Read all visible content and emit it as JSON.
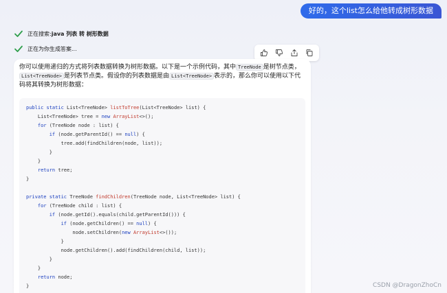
{
  "user_message": "好的，这个list怎么给他转成树形数据",
  "status": [
    {
      "prefix": "正在搜索: ",
      "bold": "java 列表 转 树形数据"
    },
    {
      "prefix": "正在为你生成答案...",
      "bold": ""
    }
  ],
  "toolbar": [
    "thumbs-up-icon",
    "thumbs-down-icon",
    "share-icon",
    "copy-icon"
  ],
  "answer": {
    "p1": "你可以使用递归的方式将列表数据转换为树形数据。以下是一个示例代码，其中",
    "c1": "TreeNode",
    "p2": "是树节点类，",
    "c2": "List<TreeNode>",
    "p3": "是列表节点类。假设你的列表数据是由",
    "c3": "List<TreeNode>",
    "p4": "表示的，那么你可以使用以下代码将其转换为树形数据："
  },
  "code_lines": [
    [
      {
        "t": "public static ",
        "c": "kw"
      },
      {
        "t": "List<TreeNode> "
      },
      {
        "t": "listToTree",
        "c": "fn"
      },
      {
        "t": "(List<TreeNode> list) {"
      }
    ],
    [
      {
        "t": "    List<TreeNode> tree = "
      },
      {
        "t": "new ",
        "c": "kw"
      },
      {
        "t": "ArrayList",
        "c": "fn"
      },
      {
        "t": "<>();"
      }
    ],
    [
      {
        "t": "    "
      },
      {
        "t": "for ",
        "c": "kw"
      },
      {
        "t": "(TreeNode node : list) {"
      }
    ],
    [
      {
        "t": "        "
      },
      {
        "t": "if ",
        "c": "kw"
      },
      {
        "t": "(node.getParentId() == "
      },
      {
        "t": "null",
        "c": "kw"
      },
      {
        "t": ") {"
      }
    ],
    [
      {
        "t": "            tree.add(findChildren(node, list));"
      }
    ],
    [
      {
        "t": "        }"
      }
    ],
    [
      {
        "t": "    }"
      }
    ],
    [
      {
        "t": "    "
      },
      {
        "t": "return ",
        "c": "kw"
      },
      {
        "t": "tree;"
      }
    ],
    [
      {
        "t": "}"
      }
    ],
    [
      {
        "t": ""
      }
    ],
    [
      {
        "t": "private static ",
        "c": "kw"
      },
      {
        "t": "TreeNode "
      },
      {
        "t": "findChildren",
        "c": "fn"
      },
      {
        "t": "(TreeNode node, List<TreeNode> list) {"
      }
    ],
    [
      {
        "t": "    "
      },
      {
        "t": "for ",
        "c": "kw"
      },
      {
        "t": "(TreeNode child : list) {"
      }
    ],
    [
      {
        "t": "        "
      },
      {
        "t": "if ",
        "c": "kw"
      },
      {
        "t": "(node.getId().equals(child.getParentId())) {"
      }
    ],
    [
      {
        "t": "            "
      },
      {
        "t": "if ",
        "c": "kw"
      },
      {
        "t": "(node.getChildren() == "
      },
      {
        "t": "null",
        "c": "kw"
      },
      {
        "t": ") {"
      }
    ],
    [
      {
        "t": "                node.setChildren("
      },
      {
        "t": "new ",
        "c": "kw"
      },
      {
        "t": "ArrayList",
        "c": "fn"
      },
      {
        "t": "<>());"
      }
    ],
    [
      {
        "t": "            }"
      }
    ],
    [
      {
        "t": "            node.getChildren().add(findChildren(child, list));"
      }
    ],
    [
      {
        "t": "        }"
      }
    ],
    [
      {
        "t": "    }"
      }
    ],
    [
      {
        "t": "    "
      },
      {
        "t": "return ",
        "c": "kw"
      },
      {
        "t": "node;"
      }
    ],
    [
      {
        "t": "}"
      }
    ]
  ],
  "watermark": "CSDN @DragonZhoCn"
}
